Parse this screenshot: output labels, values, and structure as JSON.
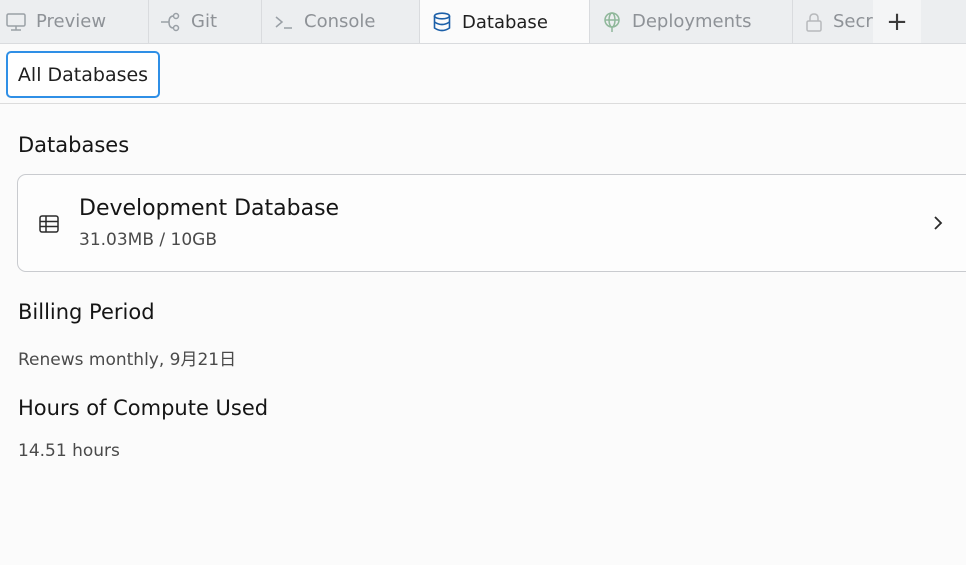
{
  "tabs": [
    {
      "label": "Preview",
      "icon": "monitor-icon"
    },
    {
      "label": "Git",
      "icon": "git-branch-icon"
    },
    {
      "label": "Console",
      "icon": "terminal-icon"
    },
    {
      "label": "Database",
      "icon": "database-icon",
      "active": true
    },
    {
      "label": "Deployments",
      "icon": "globe-icon"
    },
    {
      "label": "Secrets",
      "icon": "lock-icon"
    }
  ],
  "add_tab_label": "+",
  "toolbar": {
    "all_databases_label": "All Databases"
  },
  "databases_section": {
    "title": "Databases",
    "items": [
      {
        "name": "Development Database",
        "usage": "31.03MB / 10GB"
      }
    ]
  },
  "billing": {
    "title": "Billing Period",
    "value": "Renews monthly, 9月21日"
  },
  "compute": {
    "title": "Hours of Compute Used",
    "value": "14.51 hours"
  },
  "colors": {
    "accent": "#2f8fe6",
    "active_icon": "#1b5fa8",
    "inactive_text": "#8e9297"
  }
}
